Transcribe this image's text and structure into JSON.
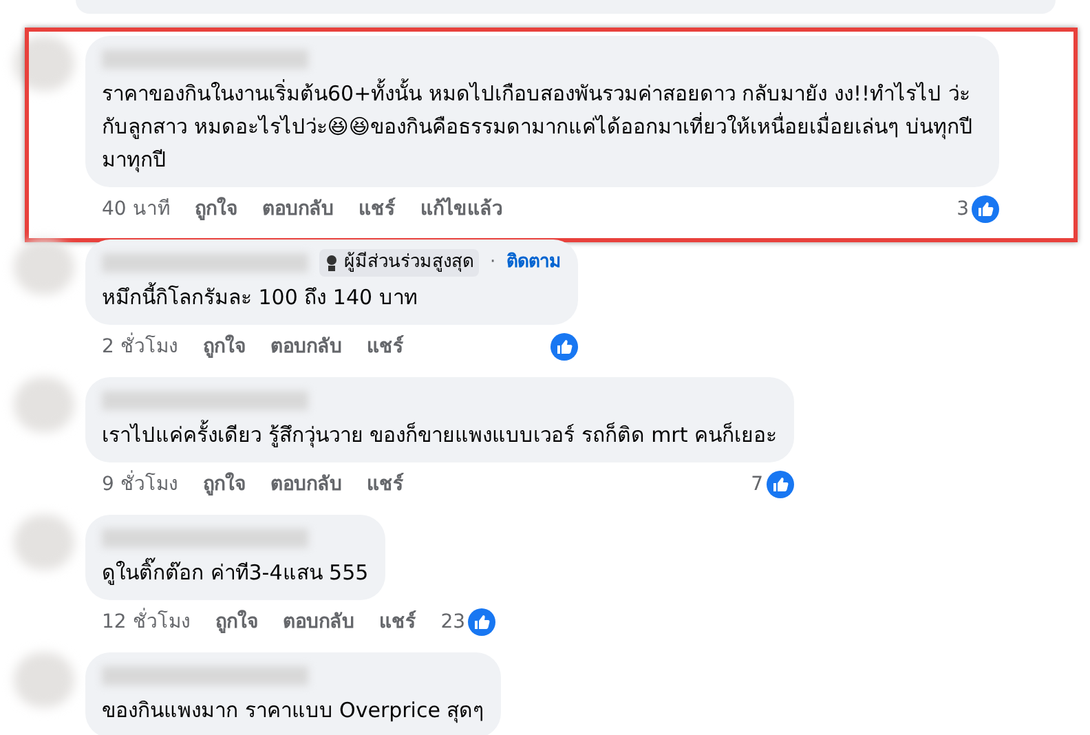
{
  "comments": [
    {
      "text": "ราคาของกินในงานเริ่มต้น60+ทั้งนั้น หมดไปเกือบสองพันรวมค่าสอยดาว กลับมายัง งง!!ทำไรไป ว่ะกับลูกสาว หมดอะไรไปว่ะ😆😆ของกินคือธรรมดามากแค่ได้ออกมาเที่ยวให้เหนื่อยเมื่อยเล่นๆ บ่นทุกปีมาทุกปี",
      "time": "40 นาที",
      "actions": [
        "ถูกใจ",
        "ตอบกลับ",
        "แชร์",
        "แก้ไขแล้ว"
      ],
      "likes": "3",
      "highlighted": true
    },
    {
      "badge": "ผู้มีส่วนร่วมสูงสุด",
      "separator": "·",
      "follow": "ติดตาม",
      "text": "หมึกนี้กิโลกรัมละ 100 ถึง 140 บาท",
      "time": "2 ชั่วโมง",
      "actions": [
        "ถูกใจ",
        "ตอบกลับ",
        "แชร์"
      ],
      "highlighted": false
    },
    {
      "text": "เราไปแค่ครั้งเดียว รู้สึกวุ่นวาย ของก็ขายแพงแบบเวอร์ รถก็ติด mrt คนก็เยอะ",
      "time": "9 ชั่วโมง",
      "actions": [
        "ถูกใจ",
        "ตอบกลับ",
        "แชร์"
      ],
      "likes": "7",
      "highlighted": false
    },
    {
      "text": "ดูในติ๊กต๊อก ค่าที3-4แสน 555",
      "time": "12 ชั่วโมง",
      "actions": [
        "ถูกใจ",
        "ตอบกลับ",
        "แชร์"
      ],
      "likes": "23",
      "highlighted": false
    },
    {
      "text": "ของกินแพงมาก ราคาแบบ Overprice สุดๆ",
      "highlighted": false
    }
  ]
}
